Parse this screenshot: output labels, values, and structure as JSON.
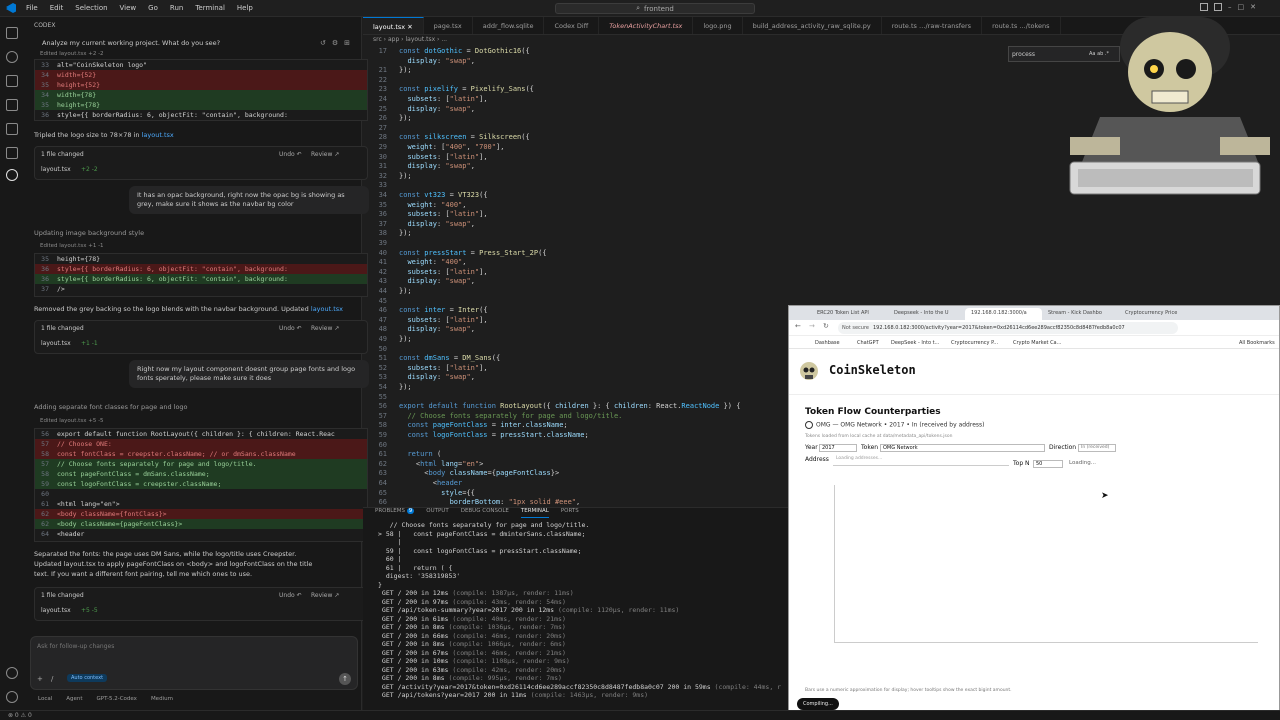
{
  "titlebar": {
    "menus": [
      "File",
      "Edit",
      "Selection",
      "View",
      "Go",
      "Run",
      "Terminal",
      "Help"
    ],
    "search": "frontend"
  },
  "chat": {
    "header": "CODEX",
    "prompt_title": "Analyze my current working project. What do you see?",
    "edit1_label": "Edited layout.tsx +2 -2",
    "edit1_lines": [
      {
        "n": "33",
        "t": "          alt=\"CoinSkeleton logo\"",
        "k": ""
      },
      {
        "n": "34",
        "t": "          width={52}",
        "k": "del"
      },
      {
        "n": "35",
        "t": "          height={52}",
        "k": "del"
      },
      {
        "n": "34",
        "t": "          width={78}",
        "k": "add"
      },
      {
        "n": "35",
        "t": "          height={78}",
        "k": "add"
      },
      {
        "n": "36",
        "t": "          style={{ borderRadius: 6, objectFit: \"contain\", background:",
        "k": ""
      }
    ],
    "msg1": "Tripled the logo size to 78×78 in",
    "msg1_file": "layout.tsx",
    "files_changed": "1 file changed",
    "undo": "Undo ↶",
    "review": "Review ↗",
    "file_layout": "layout.tsx",
    "file1_diff": "+2 -2",
    "user1": "It has an opac background, right now the opac bg is showing as grey, make sure it shows as the navbar bg color",
    "status1": "Updating image background style",
    "edit2_label": "Edited layout.tsx +1 -1",
    "edit2_lines": [
      {
        "n": "35",
        "t": "          height={78}",
        "k": ""
      },
      {
        "n": "36",
        "t": "          style={{ borderRadius: 6, objectFit: \"contain\", background:",
        "k": "del"
      },
      {
        "n": "36",
        "t": "          style={{ borderRadius: 6, objectFit: \"contain\", background:",
        "k": "add"
      },
      {
        "n": "37",
        "t": "          />",
        "k": ""
      }
    ],
    "msg2": "Removed the grey backing so the logo blends with the navbar background. Updated",
    "msg2_file": "layout.tsx",
    "file2_diff": "+1 -1",
    "user2": "Right now my layout component doesnt group page fonts and logo fonts sperately, please make sure it does",
    "status2": "Adding separate font classes for page and logo",
    "edit3_label": "Edited layout.tsx +5 -5",
    "edit3_lines": [
      {
        "n": "56",
        "t": "export default function RootLayout({ children }: { children: React.Reac",
        "k": ""
      },
      {
        "n": "57",
        "t": "  // Choose ONE:",
        "k": "del"
      },
      {
        "n": "58",
        "t": "  const fontClass = creepster.className; // or dmSans.className",
        "k": "del"
      },
      {
        "n": "57",
        "t": "  // Choose fonts separately for page and logo/title.",
        "k": "add"
      },
      {
        "n": "58",
        "t": "  const pageFontClass = dmSans.className;",
        "k": "add"
      },
      {
        "n": "59",
        "t": "  const logoFontClass = creepster.className;",
        "k": "add"
      },
      {
        "n": "60",
        "t": "",
        "k": ""
      },
      {
        "n": "61",
        "t": "    <html lang=\"en\">",
        "k": ""
      },
      {
        "n": "62",
        "t": "      <body className={fontClass}>",
        "k": "del"
      },
      {
        "n": "62",
        "t": "      <body className={pageFontClass}>",
        "k": "add"
      },
      {
        "n": "64",
        "t": "        <header",
        "k": ""
      }
    ],
    "msg3a": "Separated the fonts: the page uses DM Sans, while the logo/title uses Creepster.",
    "msg3b": "Updated layout.tsx to apply pageFontClass on <body> and logoFontClass on the title",
    "msg3c": "text. If you want a different font pairing, tell me which ones to use.",
    "file3_diff": "+5 -5",
    "input_placeholder": "Ask for follow-up changes",
    "auto_context": "Auto context",
    "local": "Local",
    "agent": "Agent",
    "model": "GPT-5.2-Codex",
    "effort": "Medium"
  },
  "tabs": [
    "layout.tsx",
    "page.tsx",
    "addr_flow.sqlite",
    "Codex Diff",
    "TokenActivityChart.tsx",
    "logo.png",
    "build_address_activity_raw_sqlite.py",
    "route.ts …/raw-transfers",
    "route.ts …/tokens"
  ],
  "breadcrumbs": "src › app › layout.tsx › ...",
  "find": {
    "value": "process",
    "opts": "Aa ab .*"
  },
  "editor_lines": [
    {
      "n": "17",
      "h": "<span class='kw'>const</span> <span class='cn'>dotGothic</span> <span class='pl'>=</span> <span class='fn'>DotGothic16</span><span class='pl'>({</span>"
    },
    {
      "n": "",
      "h": "  <span class='vr'>display</span><span class='pl'>: </span><span class='str'>\"swap\"</span><span class='pl'>,</span>"
    },
    {
      "n": "21",
      "h": "<span class='pl'>});</span>"
    },
    {
      "n": "22",
      "h": ""
    },
    {
      "n": "23",
      "h": "<span class='kw'>const</span> <span class='cn'>pixelify</span> <span class='pl'>=</span> <span class='fn'>Pixelify_Sans</span><span class='pl'>({</span>"
    },
    {
      "n": "24",
      "h": "  <span class='vr'>subsets</span><span class='pl'>: [</span><span class='str'>\"latin\"</span><span class='pl'>],</span>"
    },
    {
      "n": "25",
      "h": "  <span class='vr'>display</span><span class='pl'>: </span><span class='str'>\"swap\"</span><span class='pl'>,</span>"
    },
    {
      "n": "26",
      "h": "<span class='pl'>});</span>"
    },
    {
      "n": "27",
      "h": ""
    },
    {
      "n": "28",
      "h": "<span class='kw'>const</span> <span class='cn'>silkscreen</span> <span class='pl'>=</span> <span class='fn'>Silkscreen</span><span class='pl'>({</span>"
    },
    {
      "n": "29",
      "h": "  <span class='vr'>weight</span><span class='pl'>: [</span><span class='str'>\"400\"</span><span class='pl'>, </span><span class='str'>\"700\"</span><span class='pl'>],</span>"
    },
    {
      "n": "30",
      "h": "  <span class='vr'>subsets</span><span class='pl'>: [</span><span class='str'>\"latin\"</span><span class='pl'>],</span>"
    },
    {
      "n": "31",
      "h": "  <span class='vr'>display</span><span class='pl'>: </span><span class='str'>\"swap\"</span><span class='pl'>,</span>"
    },
    {
      "n": "32",
      "h": "<span class='pl'>});</span>"
    },
    {
      "n": "33",
      "h": ""
    },
    {
      "n": "34",
      "h": "<span class='kw'>const</span> <span class='cn'>vt323</span> <span class='pl'>=</span> <span class='fn'>VT323</span><span class='pl'>({</span>"
    },
    {
      "n": "35",
      "h": "  <span class='vr'>weight</span><span class='pl'>: </span><span class='str'>\"400\"</span><span class='pl'>,</span>"
    },
    {
      "n": "36",
      "h": "  <span class='vr'>subsets</span><span class='pl'>: [</span><span class='str'>\"latin\"</span><span class='pl'>],</span>"
    },
    {
      "n": "37",
      "h": "  <span class='vr'>display</span><span class='pl'>: </span><span class='str'>\"swap\"</span><span class='pl'>,</span>"
    },
    {
      "n": "38",
      "h": "<span class='pl'>});</span>"
    },
    {
      "n": "39",
      "h": ""
    },
    {
      "n": "40",
      "h": "<span class='kw'>const</span> <span class='cn'>pressStart</span> <span class='pl'>=</span> <span class='fn'>Press_Start_2P</span><span class='pl'>({</span>"
    },
    {
      "n": "41",
      "h": "  <span class='vr'>weight</span><span class='pl'>: </span><span class='str'>\"400\"</span><span class='pl'>,</span>"
    },
    {
      "n": "42",
      "h": "  <span class='vr'>subsets</span><span class='pl'>: [</span><span class='str'>\"latin\"</span><span class='pl'>],</span>"
    },
    {
      "n": "43",
      "h": "  <span class='vr'>display</span><span class='pl'>: </span><span class='str'>\"swap\"</span><span class='pl'>,</span>"
    },
    {
      "n": "44",
      "h": "<span class='pl'>});</span>"
    },
    {
      "n": "45",
      "h": ""
    },
    {
      "n": "46",
      "h": "<span class='kw'>const</span> <span class='cn'>inter</span> <span class='pl'>=</span> <span class='fn'>Inter</span><span class='pl'>({</span>"
    },
    {
      "n": "47",
      "h": "  <span class='vr'>subsets</span><span class='pl'>: [</span><span class='str'>\"latin\"</span><span class='pl'>],</span>"
    },
    {
      "n": "48",
      "h": "  <span class='vr'>display</span><span class='pl'>: </span><span class='str'>\"swap\"</span><span class='pl'>,</span>"
    },
    {
      "n": "49",
      "h": "<span class='pl'>});</span>"
    },
    {
      "n": "50",
      "h": ""
    },
    {
      "n": "51",
      "h": "<span class='kw'>const</span> <span class='cn'>dmSans</span> <span class='pl'>=</span> <span class='fn'>DM_Sans</span><span class='pl'>({</span>"
    },
    {
      "n": "52",
      "h": "  <span class='vr'>subsets</span><span class='pl'>: [</span><span class='str'>\"latin\"</span><span class='pl'>],</span>"
    },
    {
      "n": "53",
      "h": "  <span class='vr'>display</span><span class='pl'>: </span><span class='str'>\"swap\"</span><span class='pl'>,</span>"
    },
    {
      "n": "54",
      "h": "<span class='pl'>});</span>"
    },
    {
      "n": "55",
      "h": ""
    },
    {
      "n": "56",
      "h": "<span class='kw'>export default function</span> <span class='fn'>RootLayout</span><span class='pl'>({ </span><span class='vr'>children</span><span class='pl'> }: { </span><span class='vr'>children</span><span class='pl'>: React.</span><span class='cn'>ReactNode</span><span class='pl'> }) {</span>"
    },
    {
      "n": "57",
      "h": "  <span class='cm'>// Choose fonts separately for page and logo/title.</span>"
    },
    {
      "n": "58",
      "h": "  <span class='kw'>const</span> <span class='cn'>pageFontClass</span> <span class='pl'>= </span><span class='vr'>inter</span><span class='pl'>.</span><span class='vr'>className</span><span class='pl'>;</span>"
    },
    {
      "n": "59",
      "h": "  <span class='kw'>const</span> <span class='cn'>logoFontClass</span> <span class='pl'>= </span><span class='vr'>pressStart</span><span class='pl'>.</span><span class='vr'>className</span><span class='pl'>;</span>"
    },
    {
      "n": "60",
      "h": ""
    },
    {
      "n": "61",
      "h": "  <span class='kw'>return</span> <span class='pl'>(</span>"
    },
    {
      "n": "62",
      "h": "    <span class='pl'>&lt;</span><span class='kw'>html</span> <span class='vr'>lang</span><span class='pl'>=</span><span class='str'>\"en\"</span><span class='pl'>&gt;</span>"
    },
    {
      "n": "63",
      "h": "      <span class='pl'>&lt;</span><span class='kw'>body</span> <span class='vr'>className</span><span class='pl'>={</span><span class='vr'>pageFontClass</span><span class='pl'>}&gt;</span>"
    },
    {
      "n": "64",
      "h": "        <span class='pl'>&lt;</span><span class='kw'>header</span>"
    },
    {
      "n": "65",
      "h": "          <span class='vr'>style</span><span class='pl'>={{</span>"
    },
    {
      "n": "66",
      "h": "            <span class='vr'>borderBottom</span><span class='pl'>: </span><span class='str'>\"1px solid #eee\"</span><span class='pl'>,</span>"
    },
    {
      "n": "67",
      "h": "            <span class='vr'>padding</span><span class='pl'>: </span><span class='str'>\"12px 16px\"</span><span class='pl'>,</span>"
    }
  ],
  "panel": {
    "tabs": [
      "PROBLEMS",
      "OUTPUT",
      "DEBUG CONSOLE",
      "TERMINAL",
      "PORTS"
    ],
    "problems_count": "9",
    "lines": [
      {
        "t": "   // Choose fonts separately for page and logo/title.",
        "c": ""
      },
      {
        "t": "> 58 |   const pageFontClass = dminterSans.className;",
        "c": ""
      },
      {
        "t": "     |",
        "c": ""
      },
      {
        "t": "  59 |   const logoFontClass = pressStart.className;",
        "c": ""
      },
      {
        "t": "  60 |",
        "c": ""
      },
      {
        "t": "  61 |   return ( {",
        "c": ""
      },
      {
        "t": "  digest: '358319853'",
        "c": ""
      },
      {
        "t": "}",
        "c": ""
      },
      {
        "t": " GET / 200 in 12ms",
        "c": "(compile: 1387µs, render: 11ms)"
      },
      {
        "t": " GET / 200 in 97ms",
        "c": "(compile: 43ms, render: 54ms)"
      },
      {
        "t": " GET /api/token-summary?year=2017 200 in 12ms",
        "c": "(compile: 1120µs, render: 11ms)"
      },
      {
        "t": " GET / 200 in 61ms",
        "c": "(compile: 40ms, render: 21ms)"
      },
      {
        "t": " GET / 200 in 8ms",
        "c": "(compile: 1036µs, render: 7ms)"
      },
      {
        "t": " GET / 200 in 66ms",
        "c": "(compile: 46ms, render: 20ms)"
      },
      {
        "t": " GET / 200 in 8ms",
        "c": "(compile: 1066µs, render: 6ms)"
      },
      {
        "t": " GET / 200 in 67ms",
        "c": "(compile: 46ms, render: 21ms)"
      },
      {
        "t": " GET / 200 in 10ms",
        "c": "(compile: 1108µs, render: 9ms)"
      },
      {
        "t": " GET / 200 in 63ms",
        "c": "(compile: 42ms, render: 20ms)"
      },
      {
        "t": " GET / 200 in 8ms",
        "c": "(compile: 995µs, render: 7ms)"
      },
      {
        "t": " GET /activity?year=2017&token=0xd26114cd6ee289accf82350c8d8487fedb8a0c07 200 in 59ms",
        "c": "(compile: 44ms, r"
      },
      {
        "t": " GET /api/tokens?year=2017 200 in 11ms",
        "c": "(compile: 1463µs, render: 9ms)"
      }
    ]
  },
  "browser": {
    "tabs": [
      "ERC20 Token List API",
      "Deepseek - Into the U",
      "192.168.0.182:3000/a",
      "Stream - Kick Dashbo",
      "Cryptocurrency Price"
    ],
    "not_secure": "Not secure",
    "url": "192.168.0.182:3000/activity?year=2017&token=0xd26114cd6ee289accf82350c8d8487fedb8a0c07",
    "bookmarks": [
      "Dashbase",
      "ChatGPT",
      "DeepSeek - Into t...",
      "Cryptocurrency P...",
      "Crypto Market Ca..."
    ],
    "all_bookmarks": "All Bookmarks",
    "brand": "CoinSkeleton",
    "heading": "Token Flow Counterparties",
    "token_line": "OMG — OMG Network • 2017 • In (received by address)",
    "subnote": "Tokens loaded from local cache at data/metadata_api/tokens.json",
    "year_label": "Year",
    "year_value": "2017",
    "token_label": "Token",
    "token_value": "OMG Network",
    "direction_label": "Direction",
    "direction_value": "In (received)",
    "address_label": "Address",
    "address_value": "Loading addresses...",
    "topn_label": "Top N",
    "topn_value": "50",
    "loading": "Loading...",
    "footer_note": "Bars use a numeric approximation for display; hover tooltips show the exact bigint amount.",
    "compiling": "Compiling..."
  },
  "status": {
    "left": "⊗ 0 ⚠ 0",
    "right": ""
  },
  "colors": {
    "accent": "#0078d4",
    "del": "#4b1818",
    "add": "#1f3b22"
  }
}
